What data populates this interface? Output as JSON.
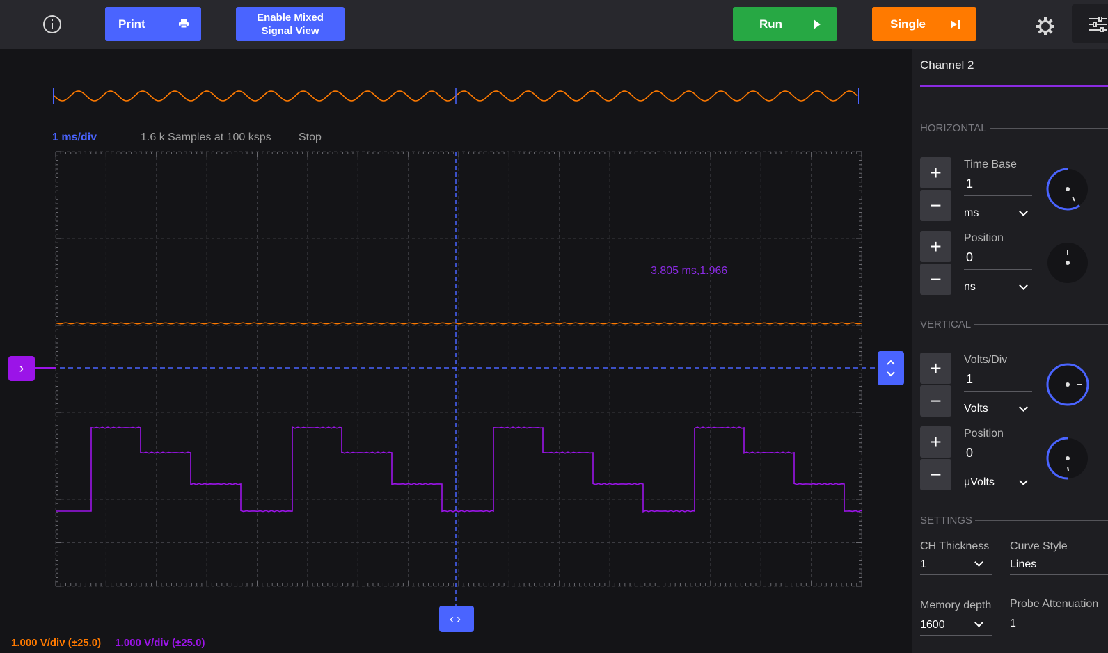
{
  "toolbar": {
    "print_label": "Print",
    "mixed_line1": "Enable Mixed",
    "mixed_line2": "Signal View",
    "run_label": "Run",
    "single_label": "Single"
  },
  "plot": {
    "time_div": "1 ms/div",
    "samples": "1.6 k Samples at 100 ksps",
    "state": "Stop",
    "cursor_readout": "3.805 ms,1.966",
    "ch1_scale": "1.000 V/div (±25.0)",
    "ch2_scale": "1.000 V/div (±25.0)",
    "colors": {
      "ch1": "#ff7a00",
      "ch2": "#9b14e8",
      "accent": "#4a64ff"
    }
  },
  "side": {
    "tab": "Channel 2",
    "horizontal": {
      "title": "HORIZONTAL",
      "timebase_label": "Time Base",
      "timebase_value": "1",
      "timebase_unit": "ms",
      "position_label": "Position",
      "position_value": "0",
      "position_unit": "ns"
    },
    "vertical": {
      "title": "VERTICAL",
      "voltsdiv_label": "Volts/Div",
      "voltsdiv_value": "1",
      "voltsdiv_unit": "Volts",
      "position_label": "Position",
      "position_value": "0",
      "position_unit": "μVolts"
    },
    "settings": {
      "title": "SETTINGS",
      "thickness_label": "CH Thickness",
      "thickness_value": "1",
      "curve_label": "Curve Style",
      "curve_value": "Lines",
      "memory_label": "Memory depth",
      "memory_value": "1600",
      "probe_label": "Probe Attenuation",
      "probe_value": "1"
    }
  }
}
